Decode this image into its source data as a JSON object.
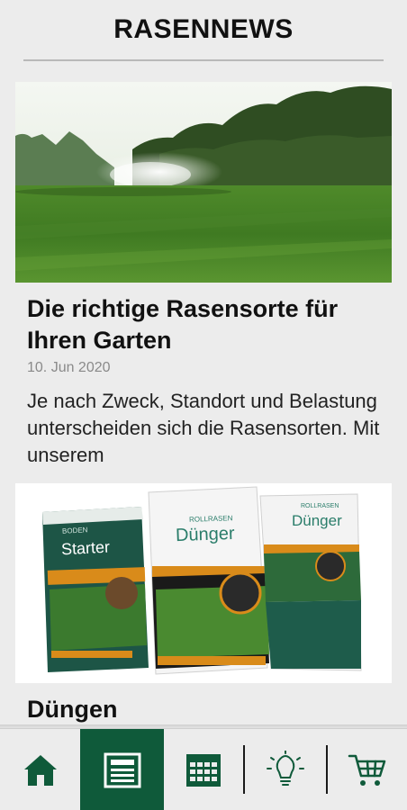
{
  "header": {
    "title": "RASENNEWS"
  },
  "articles": [
    {
      "title": "Die richtige Rasensorte für Ihren Garten",
      "date": "10. Jun 2020",
      "teaser": "Je nach Zweck, Standort und Belastung unterscheiden sich die Rasensorten. Mit unserem"
    },
    {
      "title": "Düngen",
      "products": [
        {
          "brand": "BODEN",
          "name": "Starter"
        },
        {
          "brand": "ROLLRASEN",
          "name": "Dünger"
        },
        {
          "brand": "ROLLRASEN",
          "name": "Dünger"
        }
      ]
    }
  ],
  "nav": {
    "items": [
      {
        "icon": "home-icon",
        "active": false
      },
      {
        "icon": "newspaper-icon",
        "active": true
      },
      {
        "icon": "calendar-icon",
        "active": false
      },
      {
        "icon": "lightbulb-icon",
        "active": false
      },
      {
        "icon": "shopping-cart-icon",
        "active": false
      }
    ],
    "active_color": "#0f5a3a",
    "icon_color": "#0f5a3a"
  }
}
